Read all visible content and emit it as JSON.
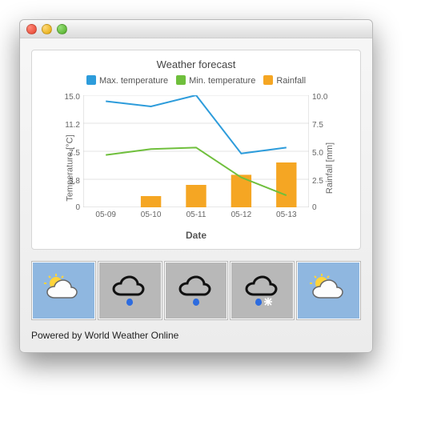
{
  "window": {
    "title": ""
  },
  "chart": {
    "title": "Weather forecast",
    "legend": {
      "max": "Max. temperature",
      "min": "Min. temperature",
      "rain": "Rainfall"
    },
    "ylabel_left": "Temperature [°C]",
    "ylabel_right": "Rainfall [mm]",
    "xlabel": "Date",
    "y_left_ticks": [
      "0",
      "3.8",
      "7.5",
      "11.2",
      "15.0"
    ],
    "y_right_ticks": [
      "0",
      "2.5",
      "5.0",
      "7.5",
      "10.0"
    ],
    "x_ticks": [
      "05-09",
      "05-10",
      "05-11",
      "05-12",
      "05-13"
    ],
    "colors": {
      "max": "#2d9cdb",
      "min": "#6fbf3c",
      "rain": "#f5a623"
    }
  },
  "attribution": "Powered by World Weather Online",
  "forecast_icons": [
    {
      "name": "sun-cloud-icon",
      "kind": "sunny"
    },
    {
      "name": "rain-cloud-icon",
      "kind": "overcast"
    },
    {
      "name": "rain-cloud-icon",
      "kind": "overcast"
    },
    {
      "name": "sleet-cloud-icon",
      "kind": "overcast"
    },
    {
      "name": "sun-cloud-icon",
      "kind": "sunny"
    }
  ],
  "chart_data": {
    "type": "line+bar",
    "categories": [
      "05-09",
      "05-10",
      "05-11",
      "05-12",
      "05-13"
    ],
    "series": [
      {
        "name": "Max. temperature",
        "type": "line",
        "axis": "left",
        "color": "#2d9cdb",
        "values": [
          14.2,
          13.5,
          15.0,
          7.2,
          8.0
        ]
      },
      {
        "name": "Min. temperature",
        "type": "line",
        "axis": "left",
        "color": "#6fbf3c",
        "values": [
          7.0,
          7.8,
          8.0,
          4.0,
          1.6
        ]
      },
      {
        "name": "Rainfall",
        "type": "bar",
        "axis": "right",
        "color": "#f5a623",
        "values": [
          0.0,
          1.0,
          2.0,
          2.9,
          4.0
        ]
      }
    ],
    "ylabel_left": "Temperature [°C]",
    "ylabel_right": "Rainfall [mm]",
    "ylim_left": [
      0,
      15.0
    ],
    "ylim_right": [
      0,
      10.0
    ],
    "xlabel": "Date",
    "title": "Weather forecast"
  }
}
